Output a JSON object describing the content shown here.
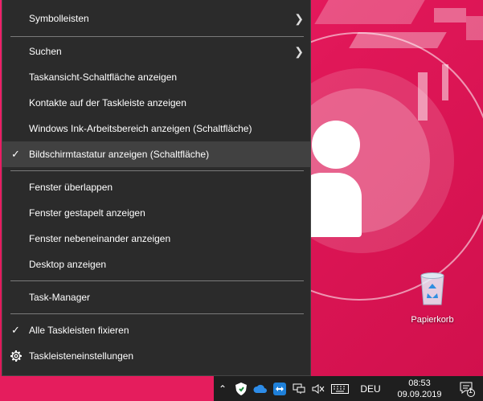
{
  "menu": {
    "items": [
      {
        "label": "Symbolleisten",
        "submenu": true
      },
      {
        "label": "Suchen",
        "submenu": true
      },
      {
        "label": "Taskansicht-Schaltfläche anzeigen"
      },
      {
        "label": "Kontakte auf der Taskleiste anzeigen"
      },
      {
        "label": "Windows Ink-Arbeitsbereich anzeigen (Schaltfläche)"
      },
      {
        "label": "Bildschirmtastatur anzeigen (Schaltfläche)",
        "checked": true,
        "highlighted": true
      },
      {
        "label": "Fenster überlappen"
      },
      {
        "label": "Fenster gestapelt anzeigen"
      },
      {
        "label": "Fenster nebeneinander anzeigen"
      },
      {
        "label": "Desktop anzeigen"
      },
      {
        "label": "Task-Manager"
      },
      {
        "label": "Alle Taskleisten fixieren",
        "checked": true
      },
      {
        "label": "Taskleisteneinstellungen",
        "icon": "gear-icon"
      }
    ]
  },
  "desktop": {
    "recycle_bin_label": "Papierkorb"
  },
  "tray": {
    "language": "DEU",
    "time": "08:53",
    "date": "09.09.2019",
    "notification_count": "1"
  },
  "colors": {
    "menu_bg": "#2b2b2b",
    "menu_highlight": "#414141",
    "wallpaper": "#e2185a",
    "tray_bg": "#1f1f1f"
  }
}
